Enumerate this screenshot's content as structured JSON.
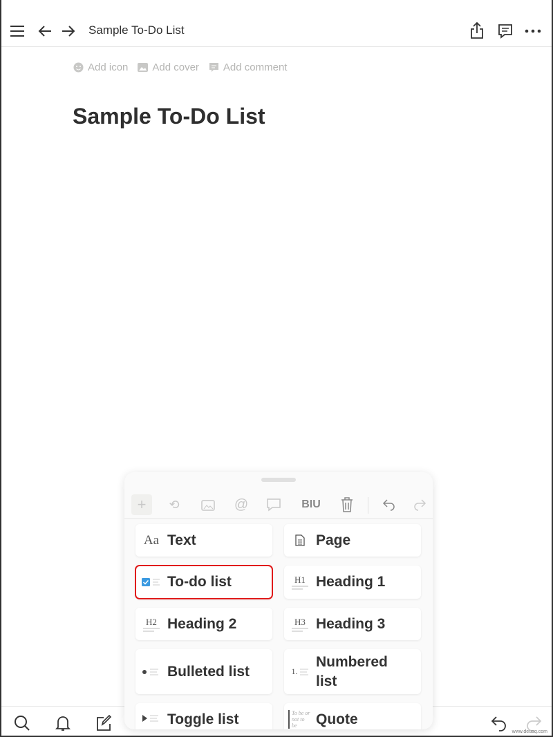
{
  "header": {
    "title": "Sample To-Do List",
    "icons": [
      "menu-icon",
      "back-arrow-icon",
      "forward-arrow-icon",
      "share-icon",
      "comment-icon",
      "more-icon"
    ]
  },
  "meta": {
    "add_icon": "Add icon",
    "add_cover": "Add cover",
    "add_comment": "Add comment"
  },
  "page": {
    "title": "Sample To-Do List"
  },
  "toolbar": {
    "format": "BIU",
    "icons": [
      "plus-icon",
      "turn-into-icon",
      "image-icon",
      "mention-icon",
      "comment-icon",
      "format-icon",
      "trash-icon",
      "undo-icon",
      "redo-icon"
    ]
  },
  "blocks": [
    {
      "label": "Text",
      "glyph": "Aa"
    },
    {
      "label": "Page",
      "glyph": ""
    },
    {
      "label": "To-do list",
      "glyph": "",
      "selected": true
    },
    {
      "label": "Heading 1",
      "glyph": "H1"
    },
    {
      "label": "Heading 2",
      "glyph": "H2"
    },
    {
      "label": "Heading 3",
      "glyph": "H3"
    },
    {
      "label": "Bulleted list",
      "glyph": ""
    },
    {
      "label": "Numbered list",
      "glyph": "1."
    },
    {
      "label": "Toggle list",
      "glyph": ""
    },
    {
      "label": "Quote",
      "glyph": "To be or not to be"
    }
  ],
  "highlight_color": "#e01a1a",
  "bottom": {
    "icons": [
      "search-icon",
      "bell-icon",
      "compose-icon",
      "undo-icon",
      "redo-icon"
    ]
  },
  "watermark": "www.deuaq.com"
}
